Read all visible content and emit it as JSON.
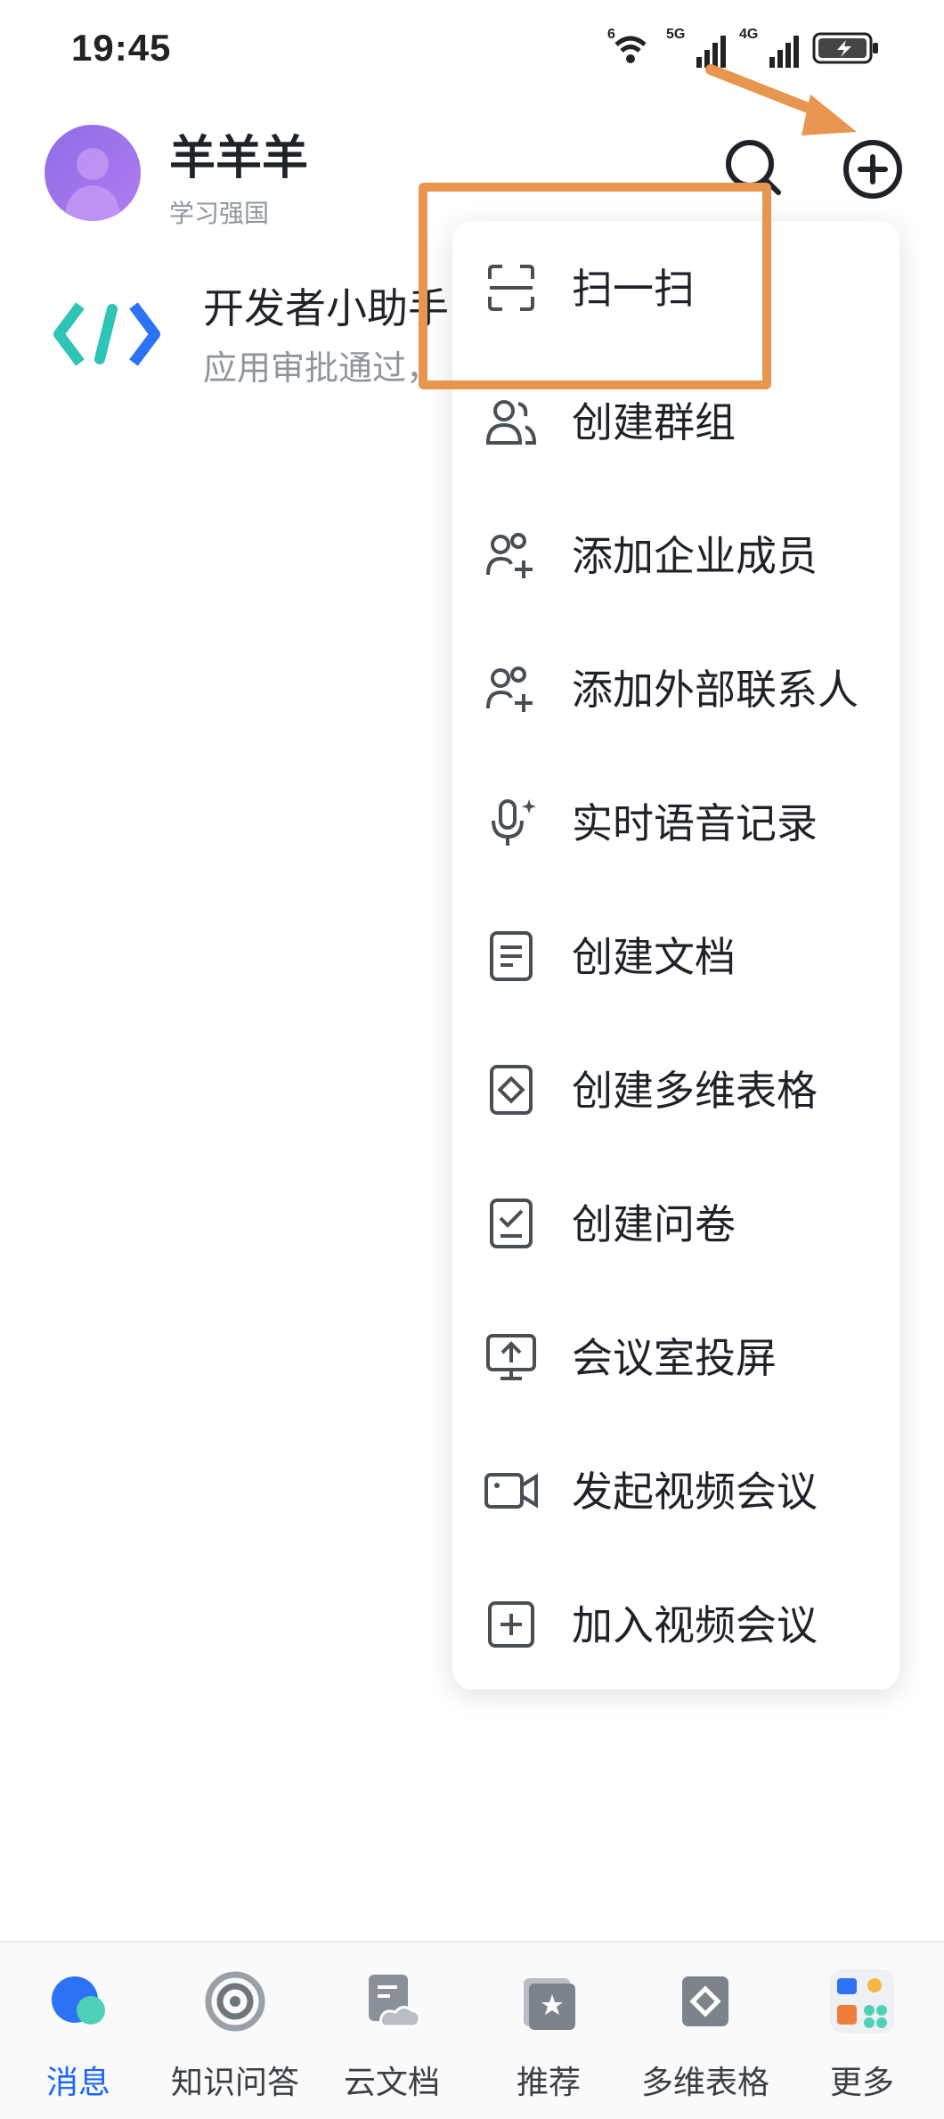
{
  "status_bar": {
    "time": "19:45",
    "wifi_label": "6",
    "signal1_label": "5G",
    "signal2_label": "4G"
  },
  "header": {
    "user_name": "羊羊羊",
    "org_name": "学习强国"
  },
  "chat_list": [
    {
      "title": "开发者小助手",
      "subtitle": "应用审批通过，"
    }
  ],
  "menu": {
    "items": [
      {
        "label": "扫一扫",
        "icon": "scan-icon"
      },
      {
        "label": "创建群组",
        "icon": "group-icon"
      },
      {
        "label": "添加企业成员",
        "icon": "add-member-icon"
      },
      {
        "label": "添加外部联系人",
        "icon": "add-contact-icon"
      },
      {
        "label": "实时语音记录",
        "icon": "microphone-icon"
      },
      {
        "label": "创建文档",
        "icon": "document-icon"
      },
      {
        "label": "创建多维表格",
        "icon": "table-icon"
      },
      {
        "label": "创建问卷",
        "icon": "survey-icon"
      },
      {
        "label": "会议室投屏",
        "icon": "screen-cast-icon"
      },
      {
        "label": "发起视频会议",
        "icon": "video-camera-icon"
      },
      {
        "label": "加入视频会议",
        "icon": "plus-square-icon"
      }
    ]
  },
  "bottom_nav": {
    "items": [
      {
        "label": "消息",
        "active": true
      },
      {
        "label": "知识问答",
        "active": false
      },
      {
        "label": "云文档",
        "active": false
      },
      {
        "label": "推荐",
        "active": false
      },
      {
        "label": "多维表格",
        "active": false
      },
      {
        "label": "更多",
        "active": false
      }
    ]
  },
  "colors": {
    "accent": "#1a66ff",
    "annotation": "#e8954f"
  }
}
